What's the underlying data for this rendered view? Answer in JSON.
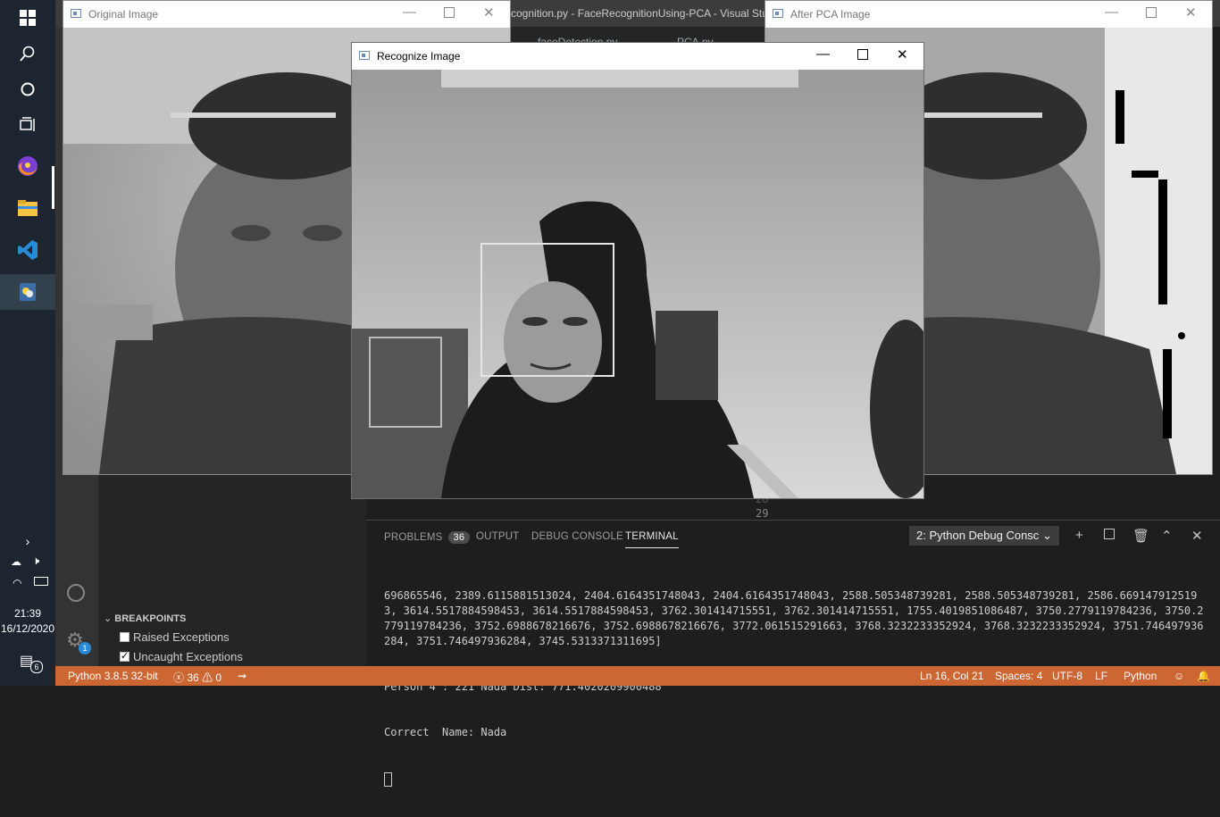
{
  "taskbar": {
    "items": [
      "windows-start",
      "search",
      "cortana",
      "task-view",
      "firefox",
      "file-explorer",
      "vscode",
      "python"
    ],
    "time": "21:39",
    "date": "16/12/2020",
    "notifications": "6"
  },
  "vscode": {
    "title": "cognition.py - FaceRecognitionUsing-PCA - Visual Stud",
    "tabs": [
      "faceDetection.py",
      "PCA.py"
    ],
    "line_numbers": [
      "28",
      "29"
    ],
    "accounts_badge": "1",
    "breakpoints": {
      "header": "BREAKPOINTS",
      "items": [
        {
          "label": "Raised Exceptions",
          "checked": false
        },
        {
          "label": "Uncaught Exceptions",
          "checked": true
        }
      ]
    },
    "panel": {
      "tabs": [
        "PROBLEMS",
        "OUTPUT",
        "DEBUG CONSOLE",
        "TERMINAL"
      ],
      "problems_count": "36",
      "active_tab": "TERMINAL",
      "terminal_select": "2: Python Debug Consc",
      "terminal_lines": [
        "696865546, 2389.6115881513024, 2404.6164351748043, 2404.6164351748043, 2588.505348739281, 2588.505348739281, 2586.6691479125193, 3614.5517884598453, 3614.5517884598453, 3762.301414715551, 3762.301414715551, 1755.4019851086487, 3750.2779119784236, 3750.2779119784236, 3752.6988678216676, 3752.6988678216676, 3772.061515291663, 3768.3232233352924, 3768.3232233352924, 3751.746497936284, 3751.746497936284, 3745.5313371311695]",
        "Person 4 : 221 Nada Dist: 771.4020209900488",
        "Correct  Name: Nada"
      ]
    },
    "statusbar": {
      "python": "Python 3.8.5 32-bit",
      "errors": "36",
      "warnings": "0",
      "position": "Ln 16, Col 21",
      "spaces": "Spaces: 4",
      "encoding": "UTF-8",
      "eol": "LF",
      "language": "Python"
    }
  },
  "windows": {
    "original": {
      "title": "Original Image"
    },
    "after_pca": {
      "title": "After PCA Image"
    },
    "recognize": {
      "title": "Recognize Image"
    }
  },
  "colors": {
    "statusbar": "#cc6633",
    "taskbar": "#1c2530",
    "vscode_blue": "#2a8bd6"
  }
}
